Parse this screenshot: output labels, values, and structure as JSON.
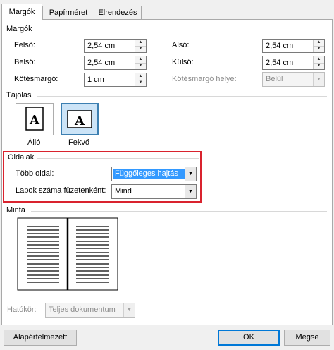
{
  "tabs": [
    {
      "label": "Margók",
      "active": true
    },
    {
      "label": "Papírméret",
      "active": false
    },
    {
      "label": "Elrendezés",
      "active": false
    }
  ],
  "margins": {
    "title": "Margók",
    "top_label": "Felső:",
    "top_value": "2,54 cm",
    "bottom_label": "Alsó:",
    "bottom_value": "2,54 cm",
    "inside_label": "Belső:",
    "inside_value": "2,54 cm",
    "outside_label": "Külső:",
    "outside_value": "2,54 cm",
    "gutter_label": "Kötésmargó:",
    "gutter_value": "1 cm",
    "gutter_pos_label": "Kötésmargó helye:",
    "gutter_pos_value": "Belül"
  },
  "orientation": {
    "title": "Tájolás",
    "portrait_label": "Álló",
    "landscape_label": "Fekvő",
    "selected": "landscape",
    "icon_letter": "A"
  },
  "pages": {
    "title": "Oldalak",
    "multiple_label": "Több oldal:",
    "multiple_value": "Függőleges hajtás",
    "sheets_label": "Lapok száma füzetenként:",
    "sheets_value": "Mind",
    "highlight_color": "#d9232e",
    "selection_color": "#3399ff"
  },
  "preview": {
    "title": "Minta",
    "apply_label": "Hatókör:",
    "apply_value": "Teljes dokumentum"
  },
  "buttons": {
    "default_label": "Alapértelmezett",
    "ok_label": "OK",
    "cancel_label": "Mégse"
  }
}
